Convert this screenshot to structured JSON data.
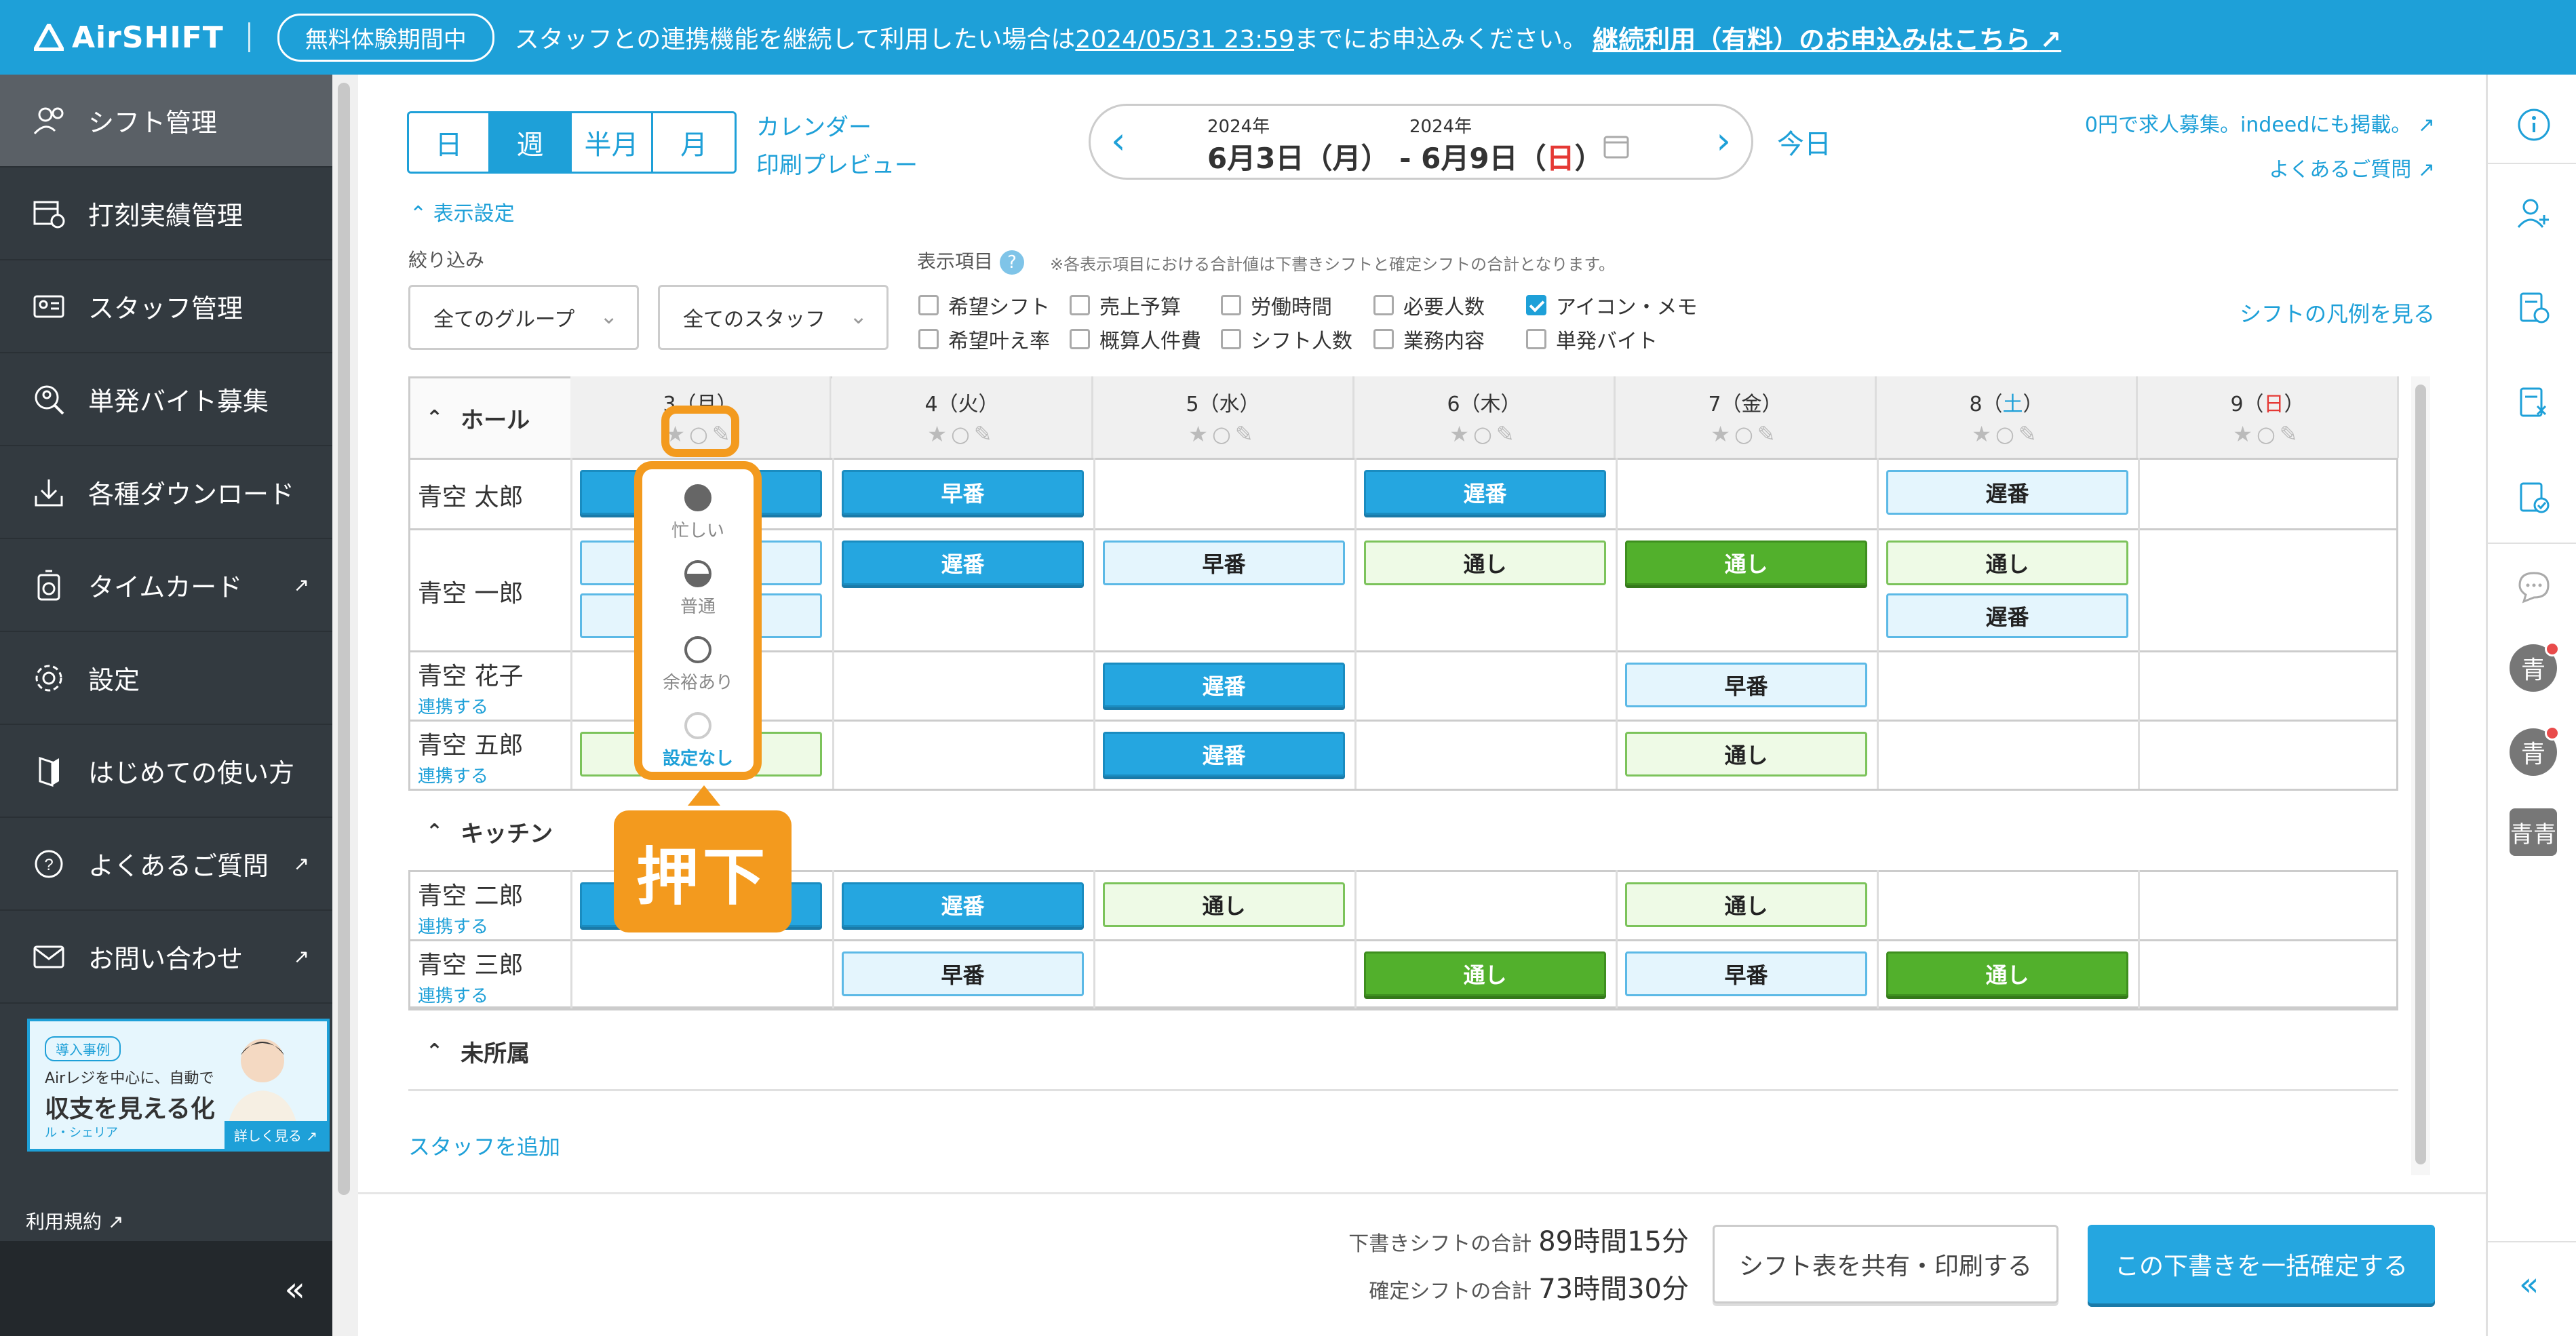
{
  "banner": {
    "app_name": "AirSHIFT",
    "trial_badge": "無料体験期間中",
    "message_pre": "スタッフとの連携機能を継続して利用したい場合は",
    "deadline": "2024/05/31 23:59",
    "message_post": "までにお申込みください。",
    "cta": "継続利用（有料）のお申込みはこちら"
  },
  "sidebar": {
    "items": [
      {
        "label": "シフト管理",
        "icon": "people-gear-icon"
      },
      {
        "label": "打刻実績管理",
        "icon": "table-clock-icon"
      },
      {
        "label": "スタッフ管理",
        "icon": "id-card-icon"
      },
      {
        "label": "単発バイト募集",
        "icon": "person-search-icon"
      },
      {
        "label": "各種ダウンロード",
        "icon": "download-icon"
      },
      {
        "label": "タイムカード",
        "icon": "timecard-icon"
      },
      {
        "label": "設定",
        "icon": "gear-icon"
      },
      {
        "label": "はじめての使い方",
        "icon": "book-icon"
      },
      {
        "label": "よくあるご質問",
        "icon": "question-icon"
      },
      {
        "label": "お問い合わせ",
        "icon": "mail-icon"
      }
    ],
    "promo": {
      "tag": "導入事例",
      "line1": "Airレジを中心に、自動で",
      "line2": "収支を見える化",
      "brand": "ル・シェリア",
      "more": "詳しく見る"
    },
    "terms": "利用規約",
    "collapse": "«"
  },
  "toolbar": {
    "view_tabs": [
      "日",
      "週",
      "半月",
      "月"
    ],
    "selected_tab": "週",
    "calendar_link": "カレンダー",
    "print_link": "印刷プレビュー",
    "date_from_year": "2024年",
    "date_to_year": "2024年",
    "date_from": "6月3日（月）",
    "date_sep": "-",
    "date_to_main": "6月9日（",
    "date_to_day": "日",
    "date_to_close": "）",
    "today": "今日",
    "recruit_link": "0円で求人募集。indeedにも掲載。",
    "faq_link": "よくあるご質問"
  },
  "settings": {
    "toggle_label": "表示設定",
    "filter_label": "絞り込み",
    "group_select": "全てのグループ",
    "staff_select": "全てのスタッフ",
    "display_label": "表示項目",
    "note": "※各表示項目における合計値は下書きシフトと確定シフトの合計となります。",
    "checks": [
      {
        "label": "希望シフト",
        "checked": false
      },
      {
        "label": "売上予算",
        "checked": false
      },
      {
        "label": "労働時間",
        "checked": false
      },
      {
        "label": "必要人数",
        "checked": false
      },
      {
        "label": "アイコン・メモ",
        "checked": true
      },
      {
        "label": "希望叶え率",
        "checked": false
      },
      {
        "label": "概算人件費",
        "checked": false
      },
      {
        "label": "シフト人数",
        "checked": false
      },
      {
        "label": "業務内容",
        "checked": false
      },
      {
        "label": "単発バイト",
        "checked": false
      }
    ],
    "legend_link": "シフトの凡例を見る"
  },
  "grid": {
    "days": [
      {
        "num": "3",
        "open": "（",
        "dow": "月",
        "close": "）",
        "weekend": ""
      },
      {
        "num": "4",
        "open": "（",
        "dow": "火",
        "close": "）",
        "weekend": ""
      },
      {
        "num": "5",
        "open": "（",
        "dow": "水",
        "close": "）",
        "weekend": ""
      },
      {
        "num": "6",
        "open": "（",
        "dow": "木",
        "close": "）",
        "weekend": ""
      },
      {
        "num": "7",
        "open": "（",
        "dow": "金",
        "close": "）",
        "weekend": ""
      },
      {
        "num": "8",
        "open": "（",
        "dow": "土",
        "close": "）",
        "weekend": "sat"
      },
      {
        "num": "9",
        "open": "（",
        "dow": "日",
        "close": "）",
        "weekend": "sun"
      }
    ],
    "sections": [
      "ホール",
      "キッチン",
      "未所属"
    ],
    "link_label": "連携する",
    "staff": [
      {
        "name": "青空 太郎"
      },
      {
        "name": "青空 一郎"
      },
      {
        "name": "青空 花子"
      },
      {
        "name": "青空 五郎"
      },
      {
        "name": "青空 二郎"
      },
      {
        "name": "青空 三郎"
      }
    ],
    "shift_labels": {
      "early": "早番",
      "late": "遅番",
      "through": "通し"
    },
    "add_staff": "スタッフを追加"
  },
  "popup": {
    "options": [
      "忙しい",
      "普通",
      "余裕あり",
      "設定なし"
    ],
    "callout": "押下"
  },
  "footer": {
    "draft_label": "下書きシフトの合計",
    "draft_total": "89時間15分",
    "confirmed_label": "確定シフトの合計",
    "confirmed_total": "73時間30分",
    "share_button": "シフト表を共有・印刷する",
    "confirm_button": "この下書きを一括確定する"
  },
  "rail": {
    "avatars": [
      "青",
      "青",
      "青青"
    ],
    "collapse": "«"
  },
  "colors": {
    "brand": "#1ea0d8",
    "highlight": "#f39a1e",
    "shift_draft_blue": "#25a6e0",
    "shift_confirmed_green": "#52b02c",
    "sunday": "#e53935",
    "saturday": "#1ea0d8"
  }
}
